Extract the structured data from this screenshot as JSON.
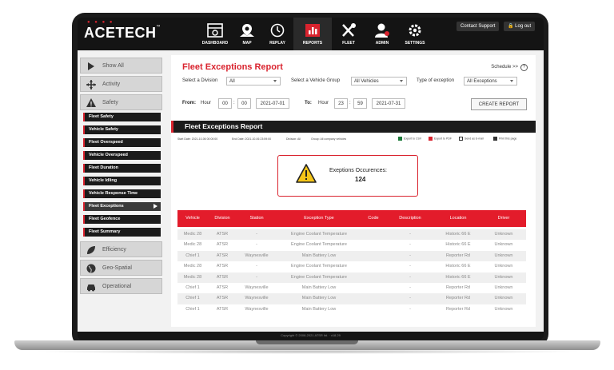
{
  "brand": {
    "logo": "ACETECH",
    "trademark": "™"
  },
  "nav": [
    {
      "label": "DASHBOARD",
      "icon": "dashboard-icon"
    },
    {
      "label": "MAP",
      "icon": "map-icon"
    },
    {
      "label": "REPLAY",
      "icon": "replay-icon"
    },
    {
      "label": "REPORTS",
      "icon": "reports-icon",
      "active": true
    },
    {
      "label": "FLEET",
      "icon": "fleet-icon"
    },
    {
      "label": "ADMIN",
      "icon": "admin-icon"
    },
    {
      "label": "SETTINGS",
      "icon": "settings-icon"
    }
  ],
  "topbar": {
    "contact_support": "Contact Support",
    "logout": "Log out"
  },
  "sidebar": {
    "groups_top": [
      "Show All",
      "Activity",
      "Safety"
    ],
    "safety_items": [
      "Fleet Safety",
      "Vehicle Safety",
      "Fleet Overspeed",
      "Vehicle Overspeed",
      "Fleet Duration",
      "Vehicle Idling",
      "Vehicle Response Time",
      "Fleet Exceptions",
      "Fleet Geofence",
      "Fleet Summary"
    ],
    "active_item": "Fleet Exceptions",
    "groups_bottom": [
      "Efficiency",
      "Geo-Spatial",
      "Operational"
    ]
  },
  "report": {
    "title": "Fleet Exceptions Report",
    "schedule": "Schedule >>",
    "help": "?",
    "division_label": "Select a Division",
    "division_value": "All",
    "group_label": "Select a Vehicle Group",
    "group_value": "All Vehicles",
    "type_label": "Type of exception",
    "type_value": "All Exceptions",
    "from_label": "From:",
    "hour_label": "Hour",
    "from_hour": "00",
    "from_min": "00",
    "from_date": "2021-07-01",
    "to_label": "To:",
    "to_hour": "23",
    "to_min": "59",
    "to_date": "2021-07-31",
    "colon": ":",
    "create_button": "CREATE REPORT",
    "section_title": "Fleet Exceptions Report",
    "meta": [
      "Start Date: 2021-10-06 00:00:00",
      "End Date: 2021-10-06 23:59:00",
      "Division: All",
      "Group: All company vehicles"
    ],
    "exports": [
      "Export to CSV",
      "Export to PDF",
      "Send as E-mail",
      "Print this page"
    ],
    "export_colors": [
      "#1d7a3a",
      "#d9232e",
      "#333333",
      "#333333"
    ],
    "alert_label": "Exeptions Occurences:",
    "alert_count": "124"
  },
  "table": {
    "headers": [
      "Vehicle",
      "Division",
      "Station",
      "Exception Type",
      "Code",
      "Description",
      "Location",
      "Driver"
    ],
    "rows": [
      [
        "Medic 28",
        "ATSR",
        "-",
        "Engine Coolant Temperature",
        "",
        "-",
        "Historic 66 E",
        "Unknown"
      ],
      [
        "Medic 28",
        "ATSR",
        "-",
        "Engine Coolant Temperature",
        "",
        "-",
        "Historic 66 E",
        "Unknown"
      ],
      [
        "Chief 1",
        "ATSR",
        "Waynesville",
        "Main Battery Low",
        "",
        "-",
        "Reporter Rd",
        "Unknown"
      ],
      [
        "Medic 28",
        "ATSR",
        "-",
        "Engine Coolant Temperature",
        "",
        "-",
        "Historic 66 E",
        "Unknown"
      ],
      [
        "Medic 28",
        "ATSR",
        "-",
        "Engine Coolant Temperature",
        "",
        "-",
        "Historic 66 E",
        "Unknown"
      ],
      [
        "Chief 1",
        "ATSR",
        "Waynesville",
        "Main Battery Low",
        "",
        "-",
        "Reporter Rd",
        "Unknown"
      ],
      [
        "Chief 1",
        "ATSR",
        "Waynesville",
        "Main Battery Low",
        "",
        "-",
        "Reporter Rd",
        "Unknown"
      ],
      [
        "Chief 1",
        "ATSR",
        "Waynesville",
        "Main Battery Low",
        "",
        "-",
        "Reporter Rd",
        "Unknown"
      ]
    ]
  },
  "footer": {
    "text": "Copyright © 2008-2021 ATSR ltd. · v18.29"
  },
  "colors": {
    "accent": "#d9232e",
    "header_red": "#e31c2b",
    "dark": "#1b1b1b"
  }
}
